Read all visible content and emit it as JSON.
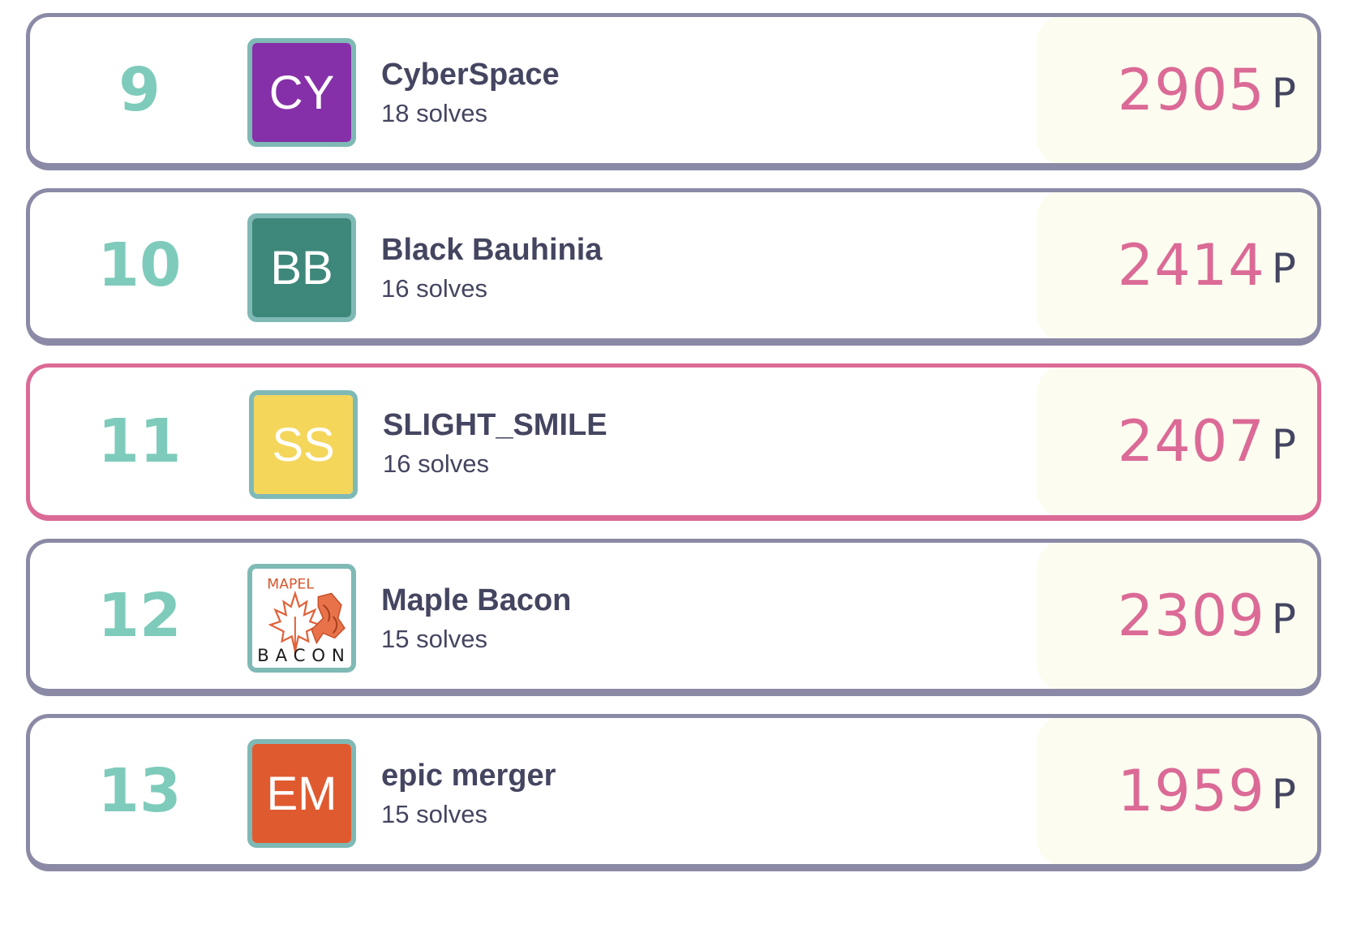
{
  "unit_label": "P",
  "rows": [
    {
      "rank": "9",
      "initials": "CY",
      "avatar_color": "#8530a8",
      "team": "CyberSpace",
      "solves": "18 solves",
      "score": "2905"
    },
    {
      "rank": "10",
      "initials": "BB",
      "avatar_color": "#3e877b",
      "team": "Black Bauhinia",
      "solves": "16 solves",
      "score": "2414"
    },
    {
      "rank": "11",
      "initials": "SS",
      "avatar_color": "#f4d65b",
      "team": "SLIGHT_SMILE",
      "solves": "16 solves",
      "score": "2407",
      "highlight": true
    },
    {
      "rank": "12",
      "initials": "",
      "avatar_image": "maple-leaf-logo",
      "avatar_logo_text_top": "MAPEL",
      "avatar_logo_text_bottom": "BACON",
      "team": "Maple Bacon",
      "solves": "15 solves",
      "score": "2309"
    },
    {
      "rank": "13",
      "initials": "EM",
      "avatar_color": "#e05a2f",
      "team": "epic merger",
      "solves": "15 solves",
      "score": "1959"
    }
  ]
}
